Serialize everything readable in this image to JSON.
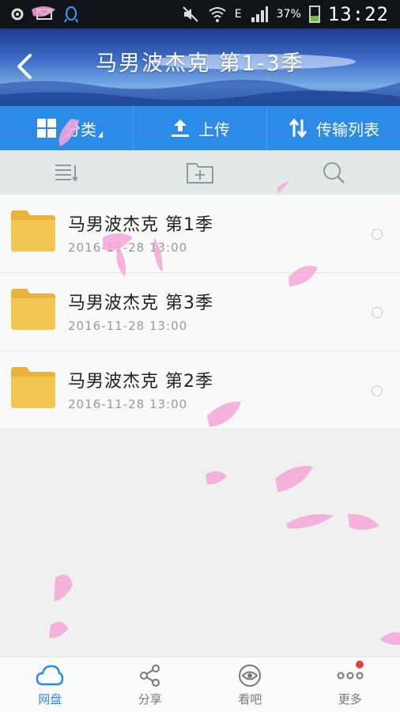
{
  "status_bar": {
    "battery_text": "37%",
    "battery_level": 0.37,
    "network_type": "E",
    "time": "13:22"
  },
  "header": {
    "title": "马男波杰克 第1-3季"
  },
  "action_bar": {
    "category_label": "分类",
    "upload_label": "上传",
    "transfer_label": "传输列表"
  },
  "files": [
    {
      "name": "马男波杰克 第1季",
      "date": "2016-11-28  13:00"
    },
    {
      "name": "马男波杰克 第3季",
      "date": "2016-11-28  13:00"
    },
    {
      "name": "马男波杰克 第2季",
      "date": "2016-11-28  13:00"
    }
  ],
  "bottom_nav": {
    "items": [
      {
        "label": "网盘",
        "icon": "cloud-icon",
        "active": true
      },
      {
        "label": "分享",
        "icon": "share-icon",
        "active": false
      },
      {
        "label": "看吧",
        "icon": "eye-icon",
        "active": false
      },
      {
        "label": "更多",
        "icon": "more-icon",
        "active": false
      }
    ]
  },
  "colors": {
    "accent": "#2b8be6",
    "folder": "#f2c14e",
    "petal": "#f4a6d8",
    "badge": "#e94040"
  }
}
